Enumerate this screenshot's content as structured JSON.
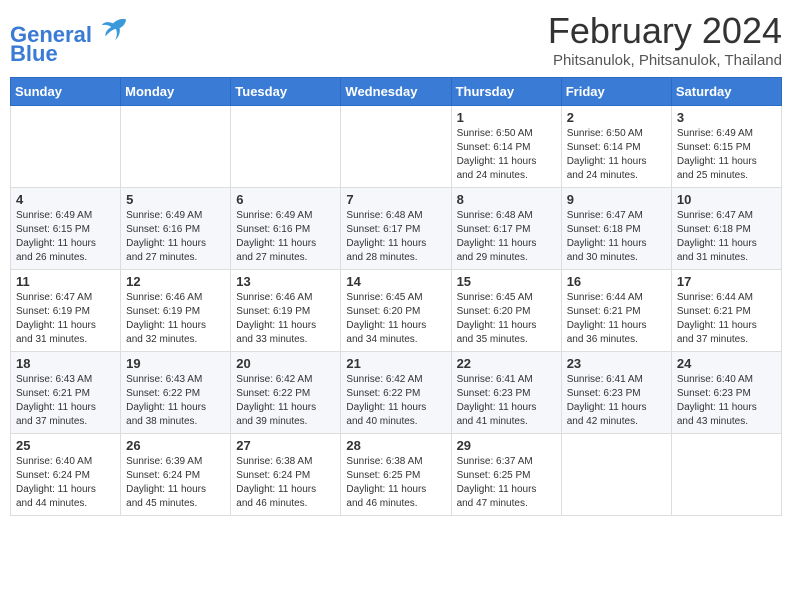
{
  "header": {
    "logo_line1": "General",
    "logo_line2": "Blue",
    "title": "February 2024",
    "subtitle": "Phitsanulok, Phitsanulok, Thailand"
  },
  "weekdays": [
    "Sunday",
    "Monday",
    "Tuesday",
    "Wednesday",
    "Thursday",
    "Friday",
    "Saturday"
  ],
  "weeks": [
    [
      {
        "day": "",
        "info": ""
      },
      {
        "day": "",
        "info": ""
      },
      {
        "day": "",
        "info": ""
      },
      {
        "day": "",
        "info": ""
      },
      {
        "day": "1",
        "info": "Sunrise: 6:50 AM\nSunset: 6:14 PM\nDaylight: 11 hours and 24 minutes."
      },
      {
        "day": "2",
        "info": "Sunrise: 6:50 AM\nSunset: 6:14 PM\nDaylight: 11 hours and 24 minutes."
      },
      {
        "day": "3",
        "info": "Sunrise: 6:49 AM\nSunset: 6:15 PM\nDaylight: 11 hours and 25 minutes."
      }
    ],
    [
      {
        "day": "4",
        "info": "Sunrise: 6:49 AM\nSunset: 6:15 PM\nDaylight: 11 hours and 26 minutes."
      },
      {
        "day": "5",
        "info": "Sunrise: 6:49 AM\nSunset: 6:16 PM\nDaylight: 11 hours and 27 minutes."
      },
      {
        "day": "6",
        "info": "Sunrise: 6:49 AM\nSunset: 6:16 PM\nDaylight: 11 hours and 27 minutes."
      },
      {
        "day": "7",
        "info": "Sunrise: 6:48 AM\nSunset: 6:17 PM\nDaylight: 11 hours and 28 minutes."
      },
      {
        "day": "8",
        "info": "Sunrise: 6:48 AM\nSunset: 6:17 PM\nDaylight: 11 hours and 29 minutes."
      },
      {
        "day": "9",
        "info": "Sunrise: 6:47 AM\nSunset: 6:18 PM\nDaylight: 11 hours and 30 minutes."
      },
      {
        "day": "10",
        "info": "Sunrise: 6:47 AM\nSunset: 6:18 PM\nDaylight: 11 hours and 31 minutes."
      }
    ],
    [
      {
        "day": "11",
        "info": "Sunrise: 6:47 AM\nSunset: 6:19 PM\nDaylight: 11 hours and 31 minutes."
      },
      {
        "day": "12",
        "info": "Sunrise: 6:46 AM\nSunset: 6:19 PM\nDaylight: 11 hours and 32 minutes."
      },
      {
        "day": "13",
        "info": "Sunrise: 6:46 AM\nSunset: 6:19 PM\nDaylight: 11 hours and 33 minutes."
      },
      {
        "day": "14",
        "info": "Sunrise: 6:45 AM\nSunset: 6:20 PM\nDaylight: 11 hours and 34 minutes."
      },
      {
        "day": "15",
        "info": "Sunrise: 6:45 AM\nSunset: 6:20 PM\nDaylight: 11 hours and 35 minutes."
      },
      {
        "day": "16",
        "info": "Sunrise: 6:44 AM\nSunset: 6:21 PM\nDaylight: 11 hours and 36 minutes."
      },
      {
        "day": "17",
        "info": "Sunrise: 6:44 AM\nSunset: 6:21 PM\nDaylight: 11 hours and 37 minutes."
      }
    ],
    [
      {
        "day": "18",
        "info": "Sunrise: 6:43 AM\nSunset: 6:21 PM\nDaylight: 11 hours and 37 minutes."
      },
      {
        "day": "19",
        "info": "Sunrise: 6:43 AM\nSunset: 6:22 PM\nDaylight: 11 hours and 38 minutes."
      },
      {
        "day": "20",
        "info": "Sunrise: 6:42 AM\nSunset: 6:22 PM\nDaylight: 11 hours and 39 minutes."
      },
      {
        "day": "21",
        "info": "Sunrise: 6:42 AM\nSunset: 6:22 PM\nDaylight: 11 hours and 40 minutes."
      },
      {
        "day": "22",
        "info": "Sunrise: 6:41 AM\nSunset: 6:23 PM\nDaylight: 11 hours and 41 minutes."
      },
      {
        "day": "23",
        "info": "Sunrise: 6:41 AM\nSunset: 6:23 PM\nDaylight: 11 hours and 42 minutes."
      },
      {
        "day": "24",
        "info": "Sunrise: 6:40 AM\nSunset: 6:23 PM\nDaylight: 11 hours and 43 minutes."
      }
    ],
    [
      {
        "day": "25",
        "info": "Sunrise: 6:40 AM\nSunset: 6:24 PM\nDaylight: 11 hours and 44 minutes."
      },
      {
        "day": "26",
        "info": "Sunrise: 6:39 AM\nSunset: 6:24 PM\nDaylight: 11 hours and 45 minutes."
      },
      {
        "day": "27",
        "info": "Sunrise: 6:38 AM\nSunset: 6:24 PM\nDaylight: 11 hours and 46 minutes."
      },
      {
        "day": "28",
        "info": "Sunrise: 6:38 AM\nSunset: 6:25 PM\nDaylight: 11 hours and 46 minutes."
      },
      {
        "day": "29",
        "info": "Sunrise: 6:37 AM\nSunset: 6:25 PM\nDaylight: 11 hours and 47 minutes."
      },
      {
        "day": "",
        "info": ""
      },
      {
        "day": "",
        "info": ""
      }
    ]
  ]
}
